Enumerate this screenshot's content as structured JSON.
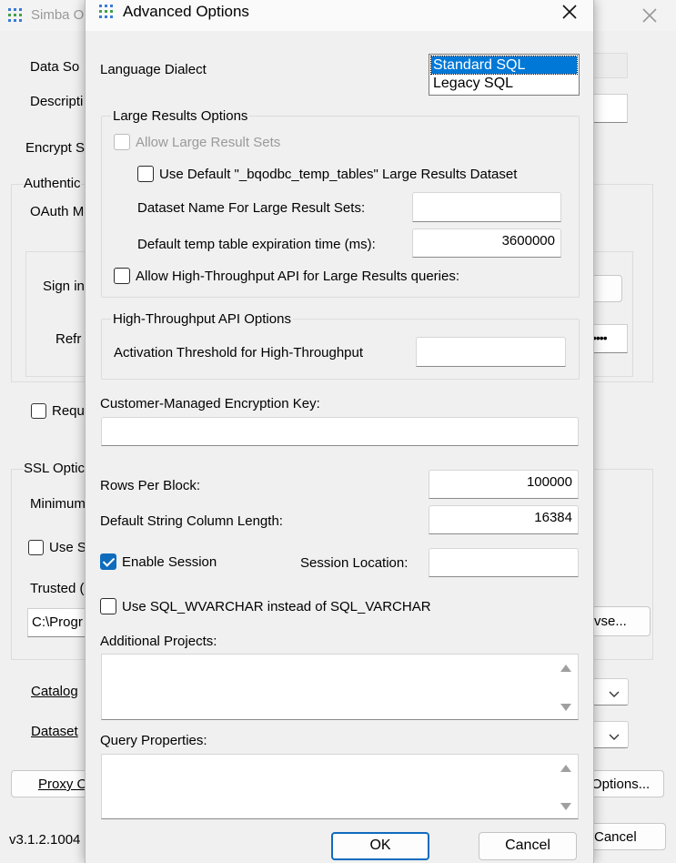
{
  "background_window": {
    "title": "Simba O",
    "labels": {
      "data_source": "Data So",
      "description": "Descripti",
      "encrypt": "Encrypt S",
      "authentication": "Authentic",
      "oauth": "OAuth M",
      "sign_in": "Sign in",
      "refresh": "Refr",
      "require": "Requ",
      "ssl_options": "SSL Optic",
      "minimum": "Minimum",
      "use": "Use S",
      "trusted": "Trusted (",
      "trusted_path": "C:\\Progr",
      "browse": "vse...",
      "catalog": "Catalog",
      "dataset": "Dataset",
      "proxy": "Proxy O",
      "options": "Options...",
      "cancel": "Cancel",
      "version": "v3.1.2.1004",
      "password_mask": "••••"
    }
  },
  "dialog": {
    "title": "Advanced Options",
    "language_dialect_label": "Language Dialect",
    "dialects": [
      "Standard SQL",
      "Legacy SQL"
    ],
    "large_results": {
      "group_title": "Large Results Options",
      "allow_large_results": "Allow Large Result Sets",
      "use_default_dataset": "Use Default \"_bqodbc_temp_tables\" Large Results Dataset",
      "dataset_name_label": "Dataset Name For Large Result Sets:",
      "dataset_name_value": "",
      "expiration_label": "Default temp table expiration time (ms):",
      "expiration_value": "3600000",
      "allow_high_throughput": "Allow High-Throughput API for Large Results queries:"
    },
    "high_throughput": {
      "group_title": "High-Throughput API Options",
      "activation_label": "Activation Threshold for High-Throughput",
      "activation_value": ""
    },
    "cmek_label": "Customer-Managed Encryption Key:",
    "cmek_value": "",
    "rows_per_block_label": "Rows Per Block:",
    "rows_per_block_value": "100000",
    "string_length_label": "Default String Column Length:",
    "string_length_value": "16384",
    "enable_session_label": "Enable Session",
    "enable_session_checked": true,
    "session_location_label": "Session Location:",
    "session_location_value": "",
    "use_wvarchar_label": "Use SQL_WVARCHAR instead of SQL_VARCHAR",
    "additional_projects_label": "Additional Projects:",
    "query_properties_label": "Query Properties:",
    "ok_label": "OK",
    "cancel_label": "Cancel"
  }
}
